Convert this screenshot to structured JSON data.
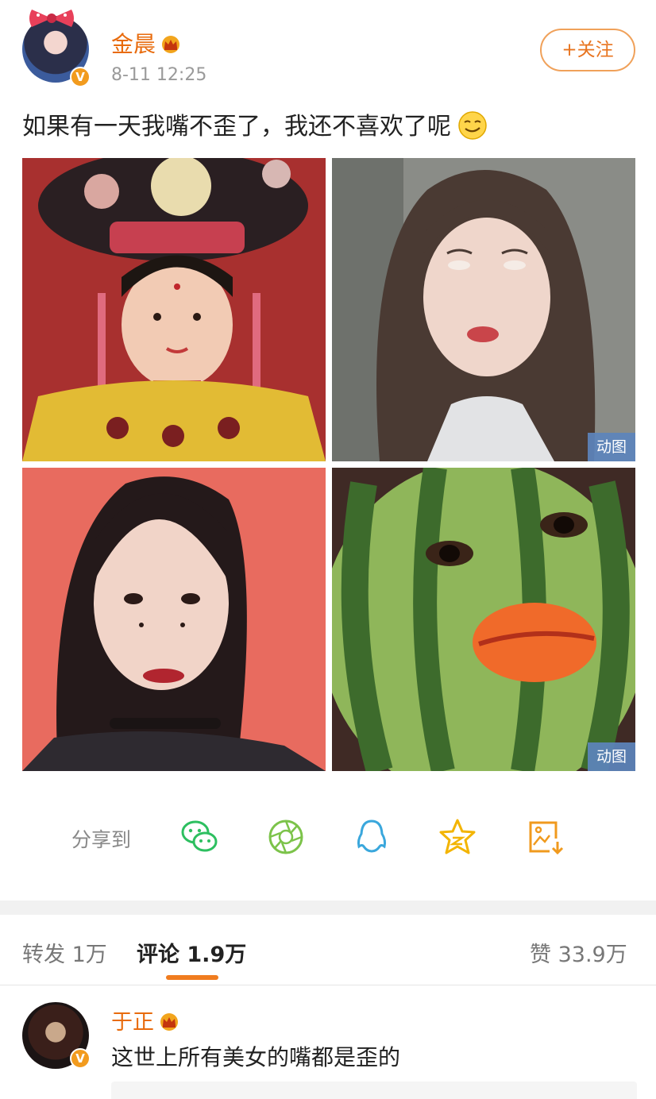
{
  "post": {
    "author": "金晨",
    "time": "8-11 12:25",
    "follow_label": "+关注",
    "text": "如果有一天我嘴不歪了，我还不喜欢了呢",
    "verified_mark": "V",
    "photos": [
      {
        "gif": false
      },
      {
        "gif": true,
        "badge": "动图"
      },
      {
        "gif": false
      },
      {
        "gif": true,
        "badge": "动图"
      }
    ]
  },
  "share": {
    "label": "分享到",
    "icons": [
      "wechat-icon",
      "moments-icon",
      "qq-icon",
      "qzone-icon",
      "save-image-icon"
    ]
  },
  "tabs": {
    "repost": "转发 1万",
    "comment": "评论 1.9万",
    "like": "赞 33.9万"
  },
  "comment": {
    "author": "于正",
    "text": "这世上所有美女的嘴都是歪的"
  },
  "colors": {
    "accent": "#e86b0d",
    "tab_underline": "#f07c1f",
    "gif_badge": "#5c84bc",
    "wechat": "#2dbf60",
    "moments": "#7cc34a",
    "qq": "#3aa7dc",
    "qzone": "#f3b400"
  }
}
